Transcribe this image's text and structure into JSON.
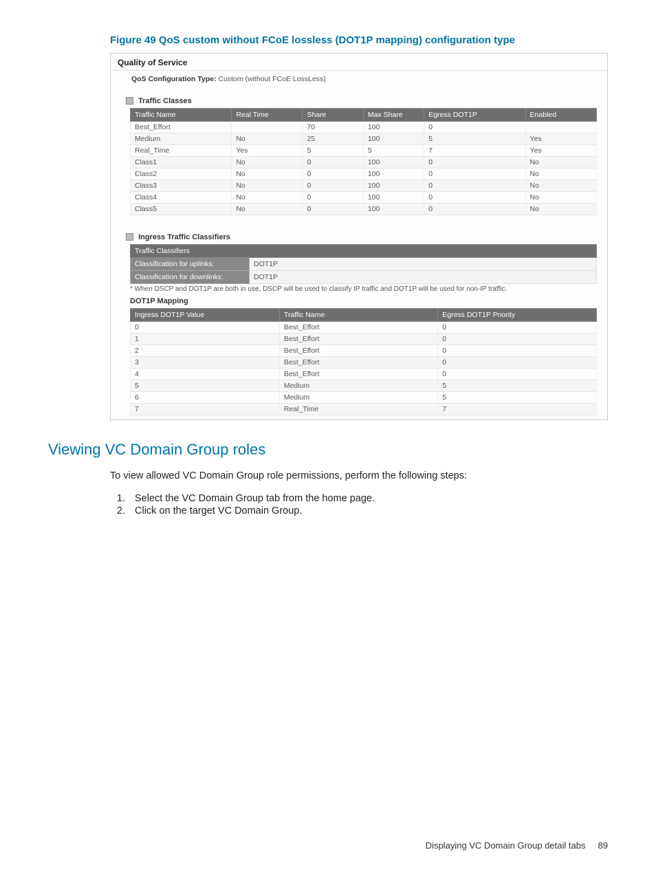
{
  "figure_caption": "Figure 49 QoS custom without FCoE lossless (DOT1P mapping) configuration type",
  "qos": {
    "title": "Quality of Service",
    "config_label": "QoS Configuration Type:",
    "config_value": "Custom (without FCoE LossLess)"
  },
  "traffic_classes": {
    "panel_title": "Traffic Classes",
    "headers": [
      "Traffic Name",
      "Real Time",
      "Share",
      "Max Share",
      "Egress DOT1P",
      "Enabled"
    ],
    "rows": [
      {
        "name": "Best_Effort",
        "realtime": "",
        "share": "70",
        "max": "100",
        "egress": "0",
        "enabled": ""
      },
      {
        "name": "Medium",
        "realtime": "No",
        "share": "25",
        "max": "100",
        "egress": "5",
        "enabled": "Yes"
      },
      {
        "name": "Real_Time",
        "realtime": "Yes",
        "share": "5",
        "max": "5",
        "egress": "7",
        "enabled": "Yes"
      },
      {
        "name": "Class1",
        "realtime": "No",
        "share": "0",
        "max": "100",
        "egress": "0",
        "enabled": "No"
      },
      {
        "name": "Class2",
        "realtime": "No",
        "share": "0",
        "max": "100",
        "egress": "0",
        "enabled": "No"
      },
      {
        "name": "Class3",
        "realtime": "No",
        "share": "0",
        "max": "100",
        "egress": "0",
        "enabled": "No"
      },
      {
        "name": "Class4",
        "realtime": "No",
        "share": "0",
        "max": "100",
        "egress": "0",
        "enabled": "No"
      },
      {
        "name": "Class5",
        "realtime": "No",
        "share": "0",
        "max": "100",
        "egress": "0",
        "enabled": "No"
      }
    ]
  },
  "ingress": {
    "panel_title": "Ingress Traffic Classifiers",
    "classifiers_header": "Traffic Classifiers",
    "uplinks_label": "Classification for uplinks:",
    "uplinks_value": "DOT1P",
    "downlinks_label": "Classification for downlinks:",
    "downlinks_value": "DOT1P",
    "footnote": "* When DSCP and DOT1P are both in use, DSCP will be used to classify IP traffic and DOT1P will be used for non-IP traffic.",
    "mapping_title": "DOT1P Mapping",
    "mapping_headers": [
      "Ingress DOT1P Value",
      "Traffic Name",
      "Egress DOT1P Priority"
    ],
    "mapping_rows": [
      {
        "val": "0",
        "name": "Best_Effort",
        "prio": "0"
      },
      {
        "val": "1",
        "name": "Best_Effort",
        "prio": "0"
      },
      {
        "val": "2",
        "name": "Best_Effort",
        "prio": "0"
      },
      {
        "val": "3",
        "name": "Best_Effort",
        "prio": "0"
      },
      {
        "val": "4",
        "name": "Best_Effort",
        "prio": "0"
      },
      {
        "val": "5",
        "name": "Medium",
        "prio": "5"
      },
      {
        "val": "6",
        "name": "Medium",
        "prio": "5"
      },
      {
        "val": "7",
        "name": "Real_Time",
        "prio": "7"
      }
    ]
  },
  "section": {
    "heading": "Viewing VC Domain Group roles",
    "intro": "To view allowed VC Domain Group role permissions, perform the following steps:",
    "steps": [
      "Select the VC Domain Group tab from the home page.",
      "Click on the target VC Domain Group."
    ]
  },
  "footer": {
    "text": "Displaying VC Domain Group detail tabs",
    "page": "89"
  }
}
